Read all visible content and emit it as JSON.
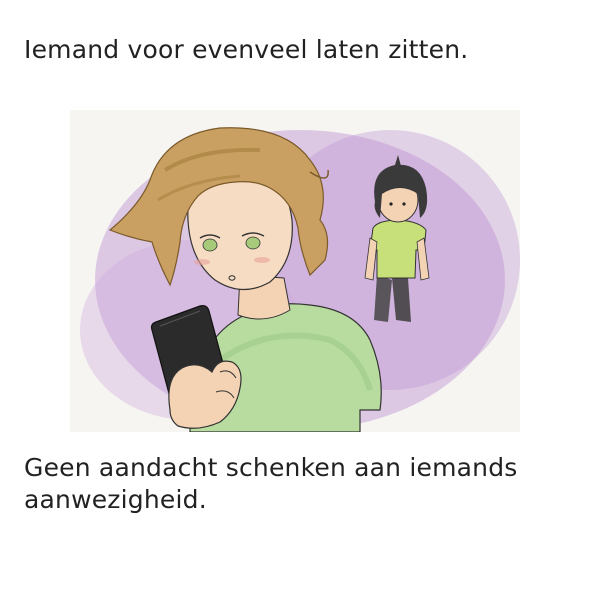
{
  "card": {
    "title": "Iemand voor evenveel laten zitten.",
    "caption": "Geen aandacht schenken aan iemands aanwezigheid."
  },
  "illustration": {
    "subject": "person looking at phone while another person stands in the background",
    "colors": {
      "background_wash": "#c9a3d9",
      "hair_main": "#c9a061",
      "shirt_main": "#a9d38a",
      "phone": "#2b2b2b",
      "skin": "#f3d3b3",
      "hair_small": "#3a3a3a",
      "shirt_small": "#c8e07a",
      "pants_small": "#444444"
    }
  }
}
